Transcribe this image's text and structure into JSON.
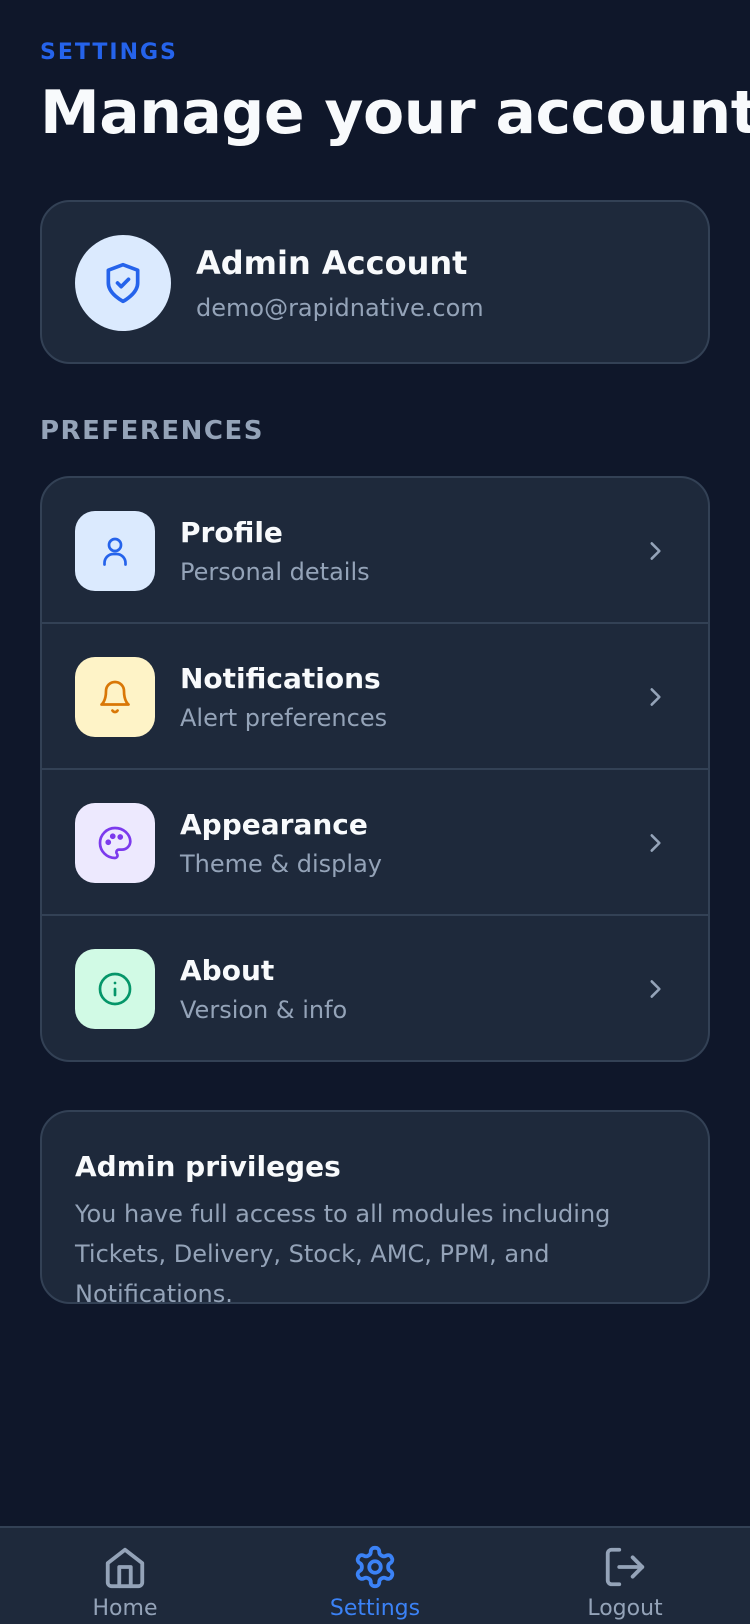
{
  "header": {
    "eyebrow": "SETTINGS",
    "title": "Manage your account"
  },
  "account": {
    "name": "Admin Account",
    "email": "demo@rapidnative.com",
    "icon": "shield-check-icon"
  },
  "preferences": {
    "label": "PREFERENCES",
    "items": [
      {
        "title": "Profile",
        "subtitle": "Personal details",
        "icon": "user-icon",
        "icon_bg": "#dbeafe",
        "icon_color": "#2563eb"
      },
      {
        "title": "Notifications",
        "subtitle": "Alert preferences",
        "icon": "bell-icon",
        "icon_bg": "#fef3c7",
        "icon_color": "#d97706"
      },
      {
        "title": "Appearance",
        "subtitle": "Theme & display",
        "icon": "palette-icon",
        "icon_bg": "#ede9fe",
        "icon_color": "#7c3aed"
      },
      {
        "title": "About",
        "subtitle": "Version & info",
        "icon": "info-icon",
        "icon_bg": "#d1fae5",
        "icon_color": "#059669"
      }
    ]
  },
  "privileges": {
    "title": "Admin privileges",
    "body": "You have full access to all modules including Tickets, Delivery, Stock, AMC, PPM, and Notifications."
  },
  "tabbar": {
    "tabs": [
      {
        "label": "Home",
        "icon": "home-icon",
        "active": false
      },
      {
        "label": "Settings",
        "icon": "gear-icon",
        "active": true
      },
      {
        "label": "Logout",
        "icon": "logout-icon",
        "active": false
      }
    ]
  },
  "colors": {
    "background": "#0f172a",
    "card": "#1e293b",
    "border": "#334155",
    "accent": "#2563eb",
    "active_tab": "#3b82f6",
    "muted": "#94a3b8"
  }
}
